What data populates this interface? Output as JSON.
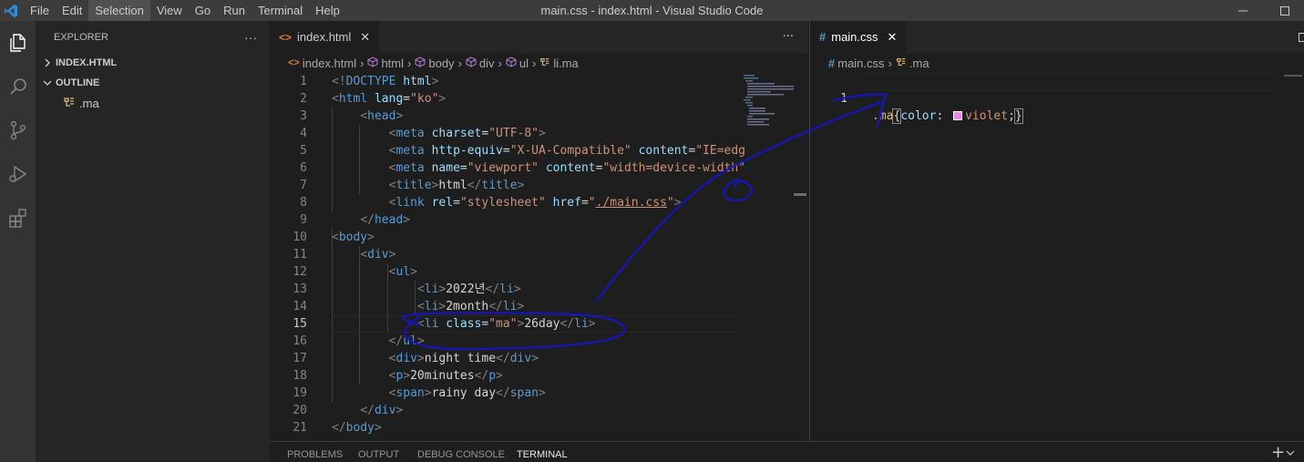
{
  "window": {
    "title": "main.css - index.html - Visual Studio Code"
  },
  "menu": [
    "File",
    "Edit",
    "Selection",
    "View",
    "Go",
    "Run",
    "Terminal",
    "Help"
  ],
  "menu_active_index": 2,
  "sidebar": {
    "header": "EXPLORER",
    "header_more": "···",
    "sections": {
      "folder": "INDEX.HTML",
      "outline": "OUTLINE"
    },
    "outline_item": ".ma"
  },
  "editor_left": {
    "tab_label": "index.html",
    "tab_close": "✕",
    "more": "···",
    "breadcrumb": [
      "index.html",
      "html",
      "body",
      "div",
      "ul",
      "li.ma"
    ],
    "current_line": 15,
    "lines": [
      {
        "n": "1",
        "tokens": [
          [
            "br",
            "<!"
          ],
          [
            "tag",
            "DOCTYPE"
          ],
          [
            "text",
            " "
          ],
          [
            "attr",
            "html"
          ],
          [
            "br",
            ">"
          ]
        ]
      },
      {
        "n": "2",
        "tokens": [
          [
            "br",
            "<"
          ],
          [
            "tag",
            "html"
          ],
          [
            "text",
            " "
          ],
          [
            "attr",
            "lang"
          ],
          [
            "text",
            "="
          ],
          [
            "str",
            "\"ko\""
          ],
          [
            "br",
            ">"
          ]
        ]
      },
      {
        "n": "3",
        "tokens": [
          [
            "text",
            "    "
          ],
          [
            "br",
            "<"
          ],
          [
            "tag",
            "head"
          ],
          [
            "br",
            ">"
          ]
        ]
      },
      {
        "n": "4",
        "tokens": [
          [
            "text",
            "        "
          ],
          [
            "br",
            "<"
          ],
          [
            "tag",
            "meta"
          ],
          [
            "text",
            " "
          ],
          [
            "attr",
            "charset"
          ],
          [
            "text",
            "="
          ],
          [
            "str",
            "\"UTF-8\""
          ],
          [
            "br",
            ">"
          ]
        ]
      },
      {
        "n": "5",
        "tokens": [
          [
            "text",
            "        "
          ],
          [
            "br",
            "<"
          ],
          [
            "tag",
            "meta"
          ],
          [
            "text",
            " "
          ],
          [
            "attr",
            "http-equiv"
          ],
          [
            "text",
            "="
          ],
          [
            "str",
            "\"X-UA-Compatible\""
          ],
          [
            "text",
            " "
          ],
          [
            "attr",
            "content"
          ],
          [
            "text",
            "="
          ],
          [
            "str",
            "\"IE=edg"
          ]
        ]
      },
      {
        "n": "6",
        "tokens": [
          [
            "text",
            "        "
          ],
          [
            "br",
            "<"
          ],
          [
            "tag",
            "meta"
          ],
          [
            "text",
            " "
          ],
          [
            "attr",
            "name"
          ],
          [
            "text",
            "="
          ],
          [
            "str",
            "\"viewport\""
          ],
          [
            "text",
            " "
          ],
          [
            "attr",
            "content"
          ],
          [
            "text",
            "="
          ],
          [
            "str",
            "\"width=device-width\""
          ]
        ]
      },
      {
        "n": "7",
        "tokens": [
          [
            "text",
            "        "
          ],
          [
            "br",
            "<"
          ],
          [
            "tag",
            "title"
          ],
          [
            "br",
            ">"
          ],
          [
            "text",
            "html"
          ],
          [
            "br",
            "</"
          ],
          [
            "tag",
            "title"
          ],
          [
            "br",
            ">"
          ]
        ]
      },
      {
        "n": "8",
        "tokens": [
          [
            "text",
            "        "
          ],
          [
            "br",
            "<"
          ],
          [
            "tag",
            "link"
          ],
          [
            "text",
            " "
          ],
          [
            "attr",
            "rel"
          ],
          [
            "text",
            "="
          ],
          [
            "str",
            "\"stylesheet\""
          ],
          [
            "text",
            " "
          ],
          [
            "attr",
            "href"
          ],
          [
            "text",
            "="
          ],
          [
            "str",
            "\""
          ],
          [
            "link",
            "./main.css"
          ],
          [
            "str",
            "\""
          ],
          [
            "br",
            ">"
          ]
        ]
      },
      {
        "n": "9",
        "tokens": [
          [
            "text",
            "    "
          ],
          [
            "br",
            "</"
          ],
          [
            "tag",
            "head"
          ],
          [
            "br",
            ">"
          ]
        ]
      },
      {
        "n": "10",
        "tokens": [
          [
            "br",
            "<"
          ],
          [
            "tag",
            "body"
          ],
          [
            "br",
            ">"
          ]
        ]
      },
      {
        "n": "11",
        "tokens": [
          [
            "text",
            "    "
          ],
          [
            "br",
            "<"
          ],
          [
            "tag",
            "div"
          ],
          [
            "br",
            ">"
          ]
        ]
      },
      {
        "n": "12",
        "tokens": [
          [
            "text",
            "        "
          ],
          [
            "br",
            "<"
          ],
          [
            "tag",
            "ul"
          ],
          [
            "br",
            ">"
          ]
        ]
      },
      {
        "n": "13",
        "tokens": [
          [
            "text",
            "            "
          ],
          [
            "br",
            "<"
          ],
          [
            "tag",
            "li"
          ],
          [
            "br",
            ">"
          ],
          [
            "text",
            "2022년"
          ],
          [
            "br",
            "</"
          ],
          [
            "tag",
            "li"
          ],
          [
            "br",
            ">"
          ]
        ]
      },
      {
        "n": "14",
        "tokens": [
          [
            "text",
            "            "
          ],
          [
            "br",
            "<"
          ],
          [
            "tag",
            "li"
          ],
          [
            "br",
            ">"
          ],
          [
            "text",
            "2month"
          ],
          [
            "br",
            "</"
          ],
          [
            "tag",
            "li"
          ],
          [
            "br",
            ">"
          ]
        ]
      },
      {
        "n": "15",
        "tokens": [
          [
            "text",
            "            "
          ],
          [
            "br",
            "<"
          ],
          [
            "tag",
            "li"
          ],
          [
            "text",
            " "
          ],
          [
            "attr",
            "class"
          ],
          [
            "text",
            "="
          ],
          [
            "str",
            "\"ma\""
          ],
          [
            "br",
            ">"
          ],
          [
            "text",
            "26day"
          ],
          [
            "br",
            "</"
          ],
          [
            "tag",
            "li"
          ],
          [
            "br",
            ">"
          ]
        ]
      },
      {
        "n": "16",
        "tokens": [
          [
            "text",
            "        "
          ],
          [
            "br",
            "</"
          ],
          [
            "tag",
            "ul"
          ],
          [
            "br",
            ">"
          ]
        ]
      },
      {
        "n": "17",
        "tokens": [
          [
            "text",
            "        "
          ],
          [
            "br",
            "<"
          ],
          [
            "tag",
            "div"
          ],
          [
            "br",
            ">"
          ],
          [
            "text",
            "night time"
          ],
          [
            "br",
            "</"
          ],
          [
            "tag",
            "div"
          ],
          [
            "br",
            ">"
          ]
        ]
      },
      {
        "n": "18",
        "tokens": [
          [
            "text",
            "        "
          ],
          [
            "br",
            "<"
          ],
          [
            "tag",
            "p"
          ],
          [
            "br",
            ">"
          ],
          [
            "text",
            "20minutes"
          ],
          [
            "br",
            "</"
          ],
          [
            "tag",
            "p"
          ],
          [
            "br",
            ">"
          ]
        ]
      },
      {
        "n": "19",
        "tokens": [
          [
            "text",
            "        "
          ],
          [
            "br",
            "<"
          ],
          [
            "tag",
            "span"
          ],
          [
            "br",
            ">"
          ],
          [
            "text",
            "rainy day"
          ],
          [
            "br",
            "</"
          ],
          [
            "tag",
            "span"
          ],
          [
            "br",
            ">"
          ]
        ]
      },
      {
        "n": "20",
        "tokens": [
          [
            "text",
            "    "
          ],
          [
            "br",
            "</"
          ],
          [
            "tag",
            "div"
          ],
          [
            "br",
            ">"
          ]
        ]
      },
      {
        "n": "21",
        "tokens": [
          [
            "br",
            "</"
          ],
          [
            "tag",
            "body"
          ],
          [
            "br",
            ">"
          ]
        ]
      }
    ]
  },
  "editor_right": {
    "tab_label": "main.css",
    "tab_close": "✕",
    "breadcrumb": [
      "main.css",
      ".ma"
    ],
    "line_number": "1",
    "selector": ".ma",
    "open_brace": "{",
    "property": "color",
    "colon": ": ",
    "value": "violet",
    "swatch_color": "#ee82ee",
    "semicolon": ";",
    "close_brace": "}"
  },
  "panel": {
    "tabs": [
      "PROBLEMS",
      "OUTPUT",
      "DEBUG CONSOLE",
      "TERMINAL"
    ],
    "active": 3,
    "add": "+"
  },
  "colors": {
    "annotation": "#1414c8",
    "activity_bar": "#333333",
    "title_bar": "#3c3c3c"
  }
}
